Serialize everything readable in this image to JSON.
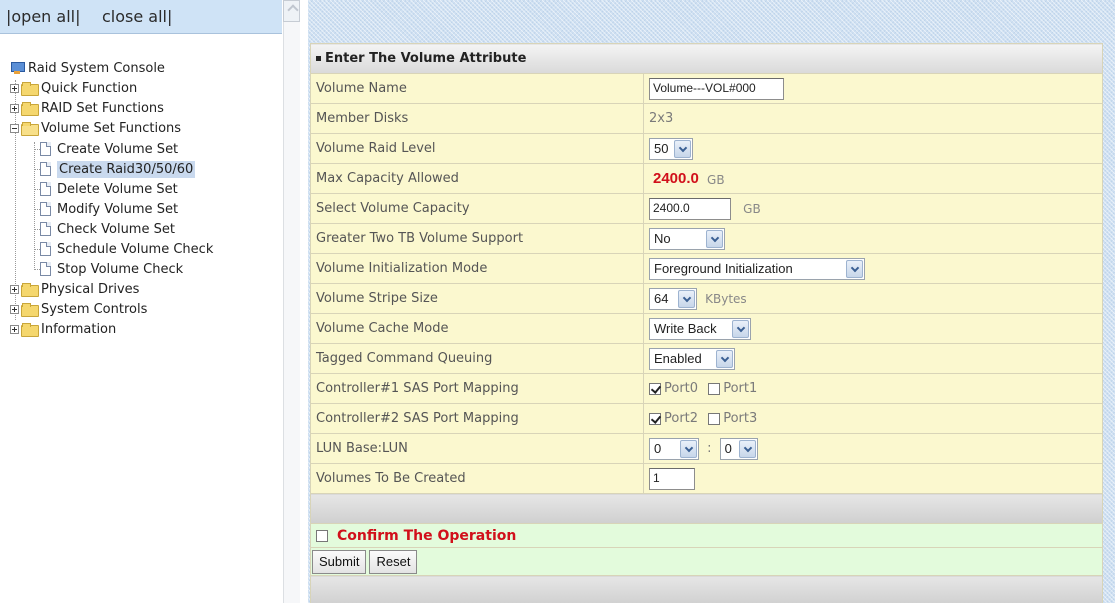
{
  "topbar": {
    "open_all": "|open all|",
    "close_all": "close all|"
  },
  "tree": {
    "root": "Raid System Console",
    "quick": "Quick Function",
    "raidset": "RAID Set Functions",
    "volset": "Volume Set Functions",
    "children": [
      "Create Volume Set",
      "Create Raid30/50/60",
      "Delete Volume Set",
      "Modify Volume Set",
      "Check Volume Set",
      "Schedule Volume Check",
      "Stop Volume Check"
    ],
    "physical": "Physical Drives",
    "system": "System Controls",
    "info": "Information"
  },
  "form": {
    "header": "Enter The Volume Attribute",
    "rows": {
      "name_label": "Volume Name",
      "name_value": "Volume---VOL#000",
      "members_label": "Member Disks",
      "members_value": "2x3",
      "raid_label": "Volume Raid Level",
      "raid_value": "50",
      "maxcap_label": "Max Capacity Allowed",
      "maxcap_value": "2400.0",
      "maxcap_unit": "GB",
      "selcap_label": "Select Volume Capacity",
      "selcap_value": "2400.0",
      "selcap_unit": "GB",
      "tb_label": "Greater Two TB Volume Support",
      "tb_value": "No",
      "init_label": "Volume Initialization Mode",
      "init_value": "Foreground Initialization",
      "stripe_label": "Volume Stripe Size",
      "stripe_value": "64",
      "stripe_unit": "KBytes",
      "cache_label": "Volume Cache Mode",
      "cache_value": "Write Back",
      "tcq_label": "Tagged Command Queuing",
      "tcq_value": "Enabled",
      "c1_label": "Controller#1 SAS Port Mapping",
      "c1_port0": "Port0",
      "c1_port1": "Port1",
      "c2_label": "Controller#2 SAS Port Mapping",
      "c2_port2": "Port2",
      "c2_port3": "Port3",
      "lun_label": "LUN Base:LUN",
      "lun_base": "0",
      "lun_sep": ":",
      "lun_value": "0",
      "count_label": "Volumes To Be Created",
      "count_value": "1"
    },
    "confirm_label": "Confirm The Operation",
    "submit": "Submit",
    "reset": "Reset"
  }
}
